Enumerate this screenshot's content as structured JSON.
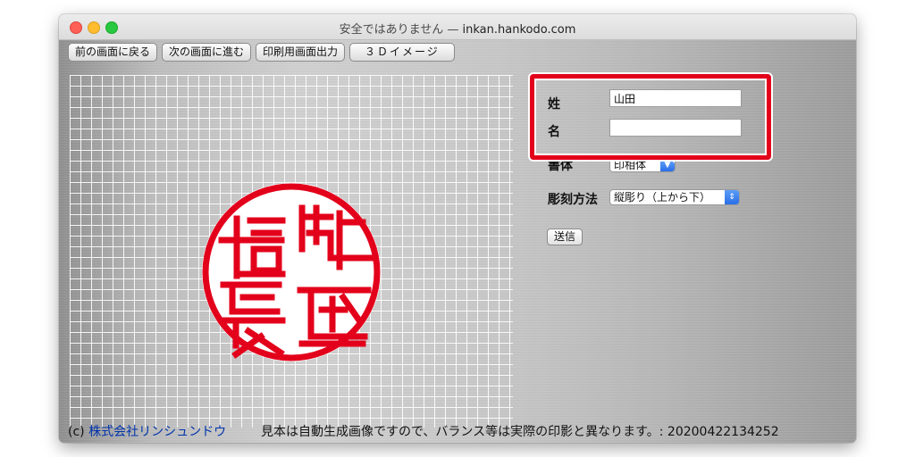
{
  "window": {
    "title_prefix": "安全ではありません —",
    "host": "inkan.hankodo.com"
  },
  "toolbar": {
    "back": "前の画面に戻る",
    "forward": "次の画面に進む",
    "print": "印刷用画面出力",
    "three_d": "３Ｄイメージ"
  },
  "stamp": {
    "characters": [
      "織",
      "田",
      "信",
      "長"
    ],
    "color": "#e3001b"
  },
  "form": {
    "surname_label": "姓",
    "surname_value": "山田",
    "given_label": "名",
    "given_value": "",
    "font_label": "書体",
    "font_value": "印相体",
    "method_label": "彫刻方法",
    "method_value": "縦彫り（上から下）",
    "submit": "送信",
    "highlight_color": "#e3001b"
  },
  "footer": {
    "copyright": "(c)",
    "company": "株式会社リンシュンドウ",
    "notice": "見本は自動生成画像ですので、バランス等は実際の印影と異なります。: 20200422134252"
  }
}
